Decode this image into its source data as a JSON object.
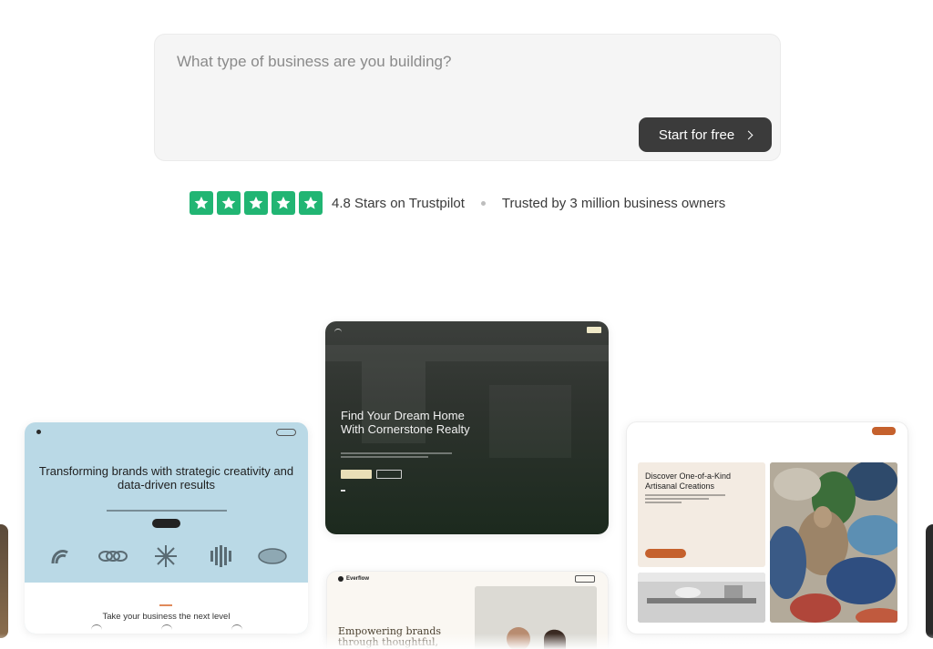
{
  "prompt": {
    "placeholder": "What type of business are you building?",
    "cta_label": "Start for free"
  },
  "trust": {
    "stars_count": 5,
    "rating_text": "4.8 Stars on Trustpilot",
    "trusted_text": "Trusted by 3 million business owners",
    "star_color": "#21b573"
  },
  "templates": {
    "realty": {
      "title": "Find Your Dream Home With Cornerstone Realty"
    },
    "sparkflow": {
      "title": "Transforming brands with strategic creativity and data-driven results",
      "tagline": "Take your business the next level"
    },
    "crafted": {
      "title": "Discover One-of-a-Kind Artisanal Creations",
      "accent_color": "#c5612d"
    },
    "everflow": {
      "logo": "Everflow",
      "title": "Empowering brands through thoughtful,"
    }
  },
  "colors": {
    "cta_bg": "#3b3b3b",
    "prompt_bg": "#f5f5f5"
  }
}
